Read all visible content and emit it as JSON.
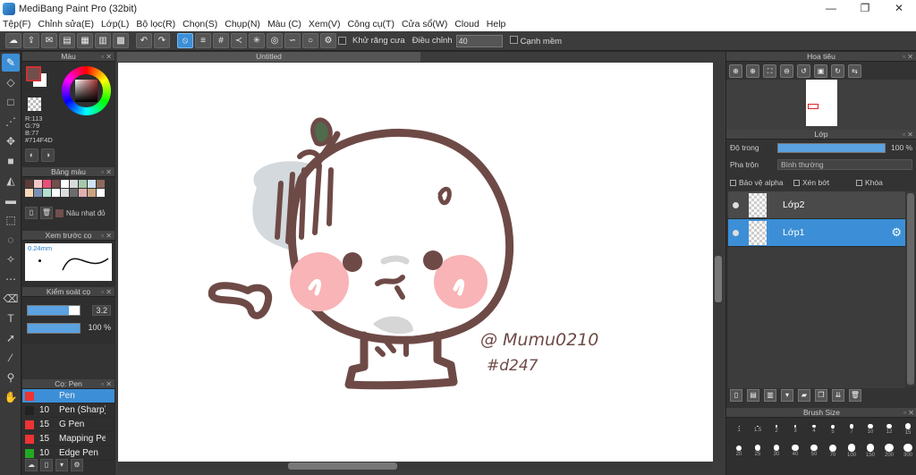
{
  "window": {
    "title": "MediBang Paint Pro (32bit)",
    "min": "—",
    "max": "❐",
    "close": "✕"
  },
  "menu": [
    "Tệp(F)",
    "Chỉnh sửa(E)",
    "Lớp(L)",
    "Bộ lọc(R)",
    "Chọn(S)",
    "Chụp(N)",
    "Màu (C)",
    "Xem(V)",
    "Công cụ(T)",
    "Cửa sổ(W)",
    "Cloud",
    "Help"
  ],
  "toolbar": {
    "antialias_label": "Khử răng cưa",
    "adjust_label": "Điều chỉnh",
    "adjust_value": "40",
    "smooth_label": "Cạnh mềm"
  },
  "color_panel": {
    "title": "Màu",
    "r": "R:113",
    "g": "G:79",
    "b": "B:77",
    "hex": "#714F4D",
    "fg": "#714f4d"
  },
  "palette": {
    "title": "Bảng màu",
    "swatches": [
      "#5c3d3a",
      "#f2c6c9",
      "#e94e77",
      "#714f4d",
      "#ffffff",
      "#d9d9d9",
      "#a6c8a8",
      "#cfe3f5",
      "#8c6a5a",
      "#f7d7b6",
      "#7a8fb2",
      "#b3e0cf",
      "#ffffff",
      "#dcdcdc",
      "#6c6c6c",
      "#e0b0b0",
      "#c9a27f",
      "#ffffff"
    ],
    "current_name": "Nâu nhạt đỏ"
  },
  "brush_preview": {
    "title": "Xem trước cọ",
    "size_label": "0.24mm"
  },
  "brush_control": {
    "title": "Kiểm soát cọ",
    "size": "3.2",
    "opacity": "100 %",
    "size_fill": 0.8,
    "opacity_fill": 1.0
  },
  "brushes": {
    "title": "Cọ: Pen",
    "items": [
      {
        "size": "",
        "name": "Pen",
        "color": "#e33",
        "selected": true
      },
      {
        "size": "10",
        "name": "Pen (Sharp)",
        "color": "#222"
      },
      {
        "size": "15",
        "name": "G Pen",
        "color": "#e33"
      },
      {
        "size": "15",
        "name": "Mapping Pen",
        "color": "#e33"
      },
      {
        "size": "10",
        "name": "Edge Pen",
        "color": "#2a2"
      }
    ]
  },
  "document": {
    "tab": "Untitled",
    "signature_line1": "@ Mumu0210",
    "signature_line2": "#d247"
  },
  "navigator": {
    "title": "Hoa tiêu"
  },
  "layer_panel": {
    "title": "Lớp",
    "opacity_label": "Độ trong",
    "opacity_value": "100 %",
    "opacity": 1.0,
    "blend_label": "Pha trộn",
    "blend_value": "Bình thường",
    "protect_alpha": "Bảo vệ alpha",
    "clipping": "Xén bớt",
    "lock": "Khóa",
    "layers": [
      {
        "name": "Lớp2",
        "selected": false
      },
      {
        "name": "Lớp1",
        "selected": true
      }
    ]
  },
  "brush_size": {
    "title": "Brush Size",
    "labels": [
      "1",
      "1.5",
      "2",
      "3",
      "4",
      "5",
      "7",
      "10",
      "12",
      "15",
      "20",
      "25",
      "30",
      "40",
      "50",
      "70",
      "100",
      "150",
      "200",
      "300"
    ]
  }
}
